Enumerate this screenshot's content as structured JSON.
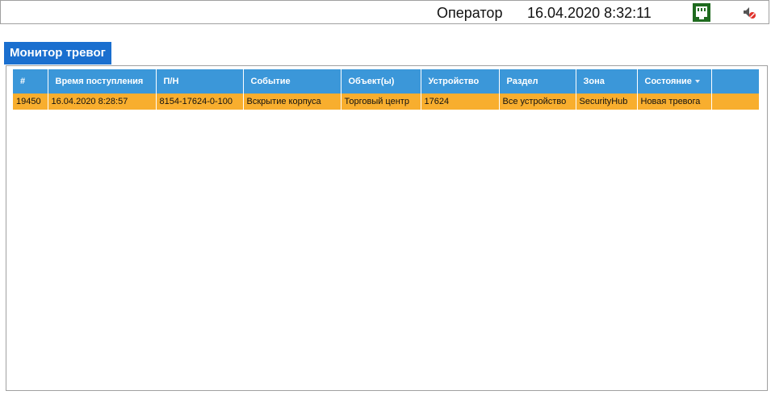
{
  "header": {
    "operator": "Оператор",
    "datetime": "16.04.2020 8:32:11",
    "icons": [
      "network-status-icon",
      "sound-muted-icon"
    ]
  },
  "tab": {
    "title": "Монитор тревог"
  },
  "table": {
    "columns": [
      "#",
      "Время поступления",
      "П/Н",
      "Событие",
      "Объект(ы)",
      "Устройство",
      "Раздел",
      "Зона",
      "Состояние",
      ""
    ],
    "sorted_column": "Состояние",
    "rows": [
      [
        "19450",
        "16.04.2020 8:28:57",
        "8154-17624-0-100",
        "Вскрытие корпуса",
        "Торговый центр",
        "17624",
        "Все устройство",
        "SecurityHub",
        "Новая тревога",
        ""
      ]
    ],
    "colors": {
      "header_bg": "#3b97d9",
      "row_alarm_bg": "#f8ae2e",
      "tab_bg": "#1a6fcf",
      "network_icon_bg": "#1f6b1f"
    }
  }
}
